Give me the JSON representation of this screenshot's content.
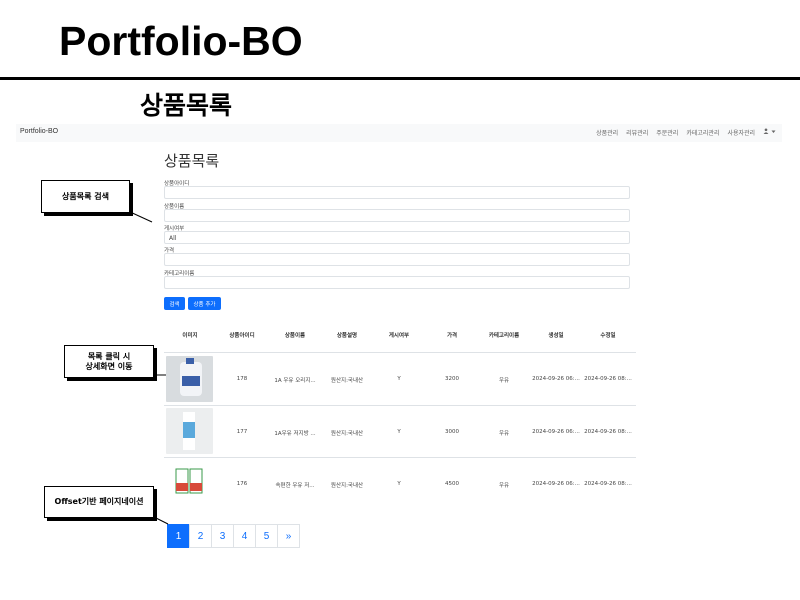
{
  "slide": {
    "title": "Portfolio-BO",
    "subtitle": "상품목록"
  },
  "navbar": {
    "brand": "Portfolio-BO",
    "links": [
      "상품관리",
      "리뷰관리",
      "주문관리",
      "카테고리관리",
      "사용자관리"
    ],
    "user_icon": "person-icon"
  },
  "page": {
    "heading": "상품목록",
    "filters": {
      "product_id_label": "상품아이디",
      "product_name_label": "상품이름",
      "posted_label": "게시여부",
      "posted_value": "All",
      "price_label": "가격",
      "category_label": "카테고리이름"
    },
    "buttons": {
      "search": "검색",
      "add": "상품 추가"
    }
  },
  "table": {
    "headers": [
      "이미지",
      "상품아이디",
      "상품이름",
      "상품설명",
      "게시여부",
      "가격",
      "카테고리이름",
      "생성일",
      "수정일"
    ],
    "rows": [
      {
        "id": "178",
        "name": "1A 우유 오리지...",
        "desc": "원산지:국내산",
        "posted": "Y",
        "price": "3200",
        "category": "우유",
        "created": "2024-09-26 06:...",
        "updated": "2024-09-26 08:..."
      },
      {
        "id": "177",
        "name": "1A우유 저지방 ...",
        "desc": "원산지:국내산",
        "posted": "Y",
        "price": "3000",
        "category": "우유",
        "created": "2024-09-26 06:...",
        "updated": "2024-09-26 08:..."
      },
      {
        "id": "176",
        "name": "속편한 우유 저...",
        "desc": "원산지:국내산",
        "posted": "Y",
        "price": "4500",
        "category": "우유",
        "created": "2024-09-26 06:...",
        "updated": "2024-09-26 08:..."
      }
    ]
  },
  "pagination": {
    "pages": [
      "1",
      "2",
      "3",
      "4",
      "5"
    ],
    "next": "»",
    "active": "1"
  },
  "callouts": {
    "search": "상품목록 검색",
    "detail_line1": "목록 클릭 시",
    "detail_line2": "상세화면 이동",
    "pagination": "Offset기반 페이지네이션"
  },
  "colors": {
    "primary": "#0d6efd",
    "navbar_bg": "#f8f9fa",
    "border": "#dee2e6"
  }
}
